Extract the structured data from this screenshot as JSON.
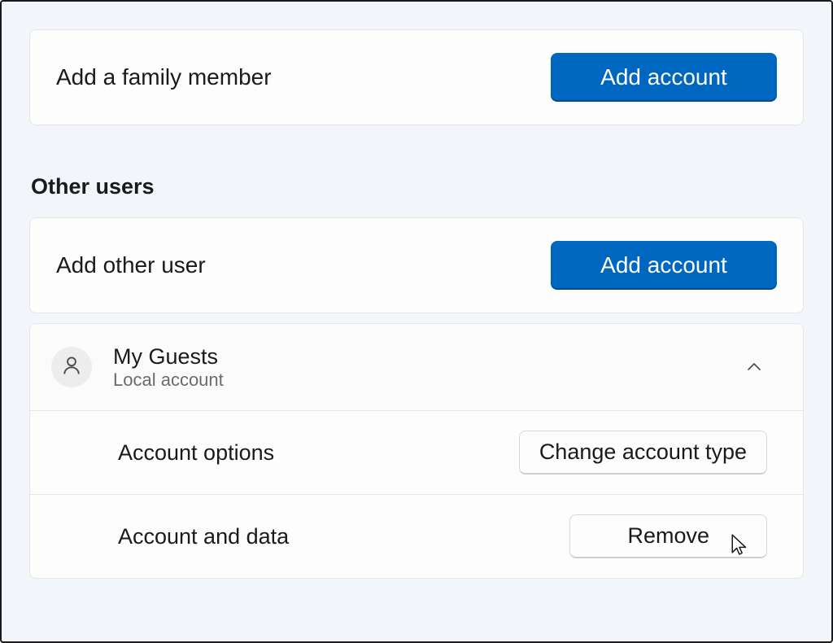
{
  "family": {
    "add_label": "Add a family member",
    "add_button": "Add account"
  },
  "other_users_heading": "Other users",
  "other": {
    "add_label": "Add other user",
    "add_button": "Add account"
  },
  "user": {
    "name": "My Guests",
    "type": "Local account",
    "options_label": "Account options",
    "change_type_button": "Change account type",
    "data_label": "Account and data",
    "remove_button": "Remove"
  }
}
